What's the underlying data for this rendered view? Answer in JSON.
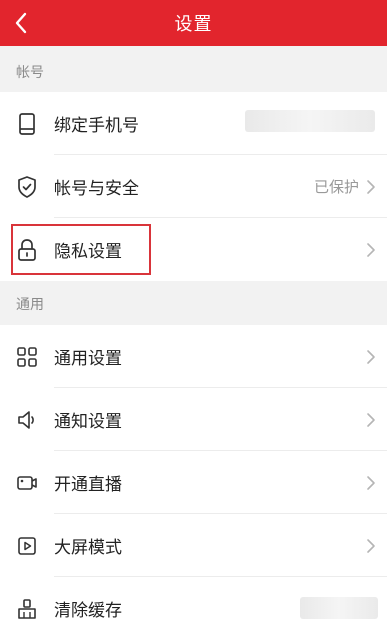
{
  "header": {
    "title": "设置",
    "back_icon": "back-arrow-icon",
    "color": "#e2252d"
  },
  "sections": {
    "account": {
      "label": "帐号"
    },
    "general": {
      "label": "通用"
    }
  },
  "account_items": [
    {
      "label": "绑定手机号",
      "icon": "phone-icon",
      "value": ""
    },
    {
      "label": "帐号与安全",
      "icon": "shield-icon",
      "value": "已保护"
    },
    {
      "label": "隐私设置",
      "icon": "lock-icon",
      "value": ""
    }
  ],
  "general_items": [
    {
      "label": "通用设置",
      "icon": "grid-icon"
    },
    {
      "label": "通知设置",
      "icon": "speaker-icon"
    },
    {
      "label": "开通直播",
      "icon": "video-camera-icon"
    },
    {
      "label": "大屏模式",
      "icon": "play-screen-icon"
    },
    {
      "label": "清除缓存",
      "icon": "broom-icon"
    }
  ],
  "highlight_color": "#d9343a"
}
